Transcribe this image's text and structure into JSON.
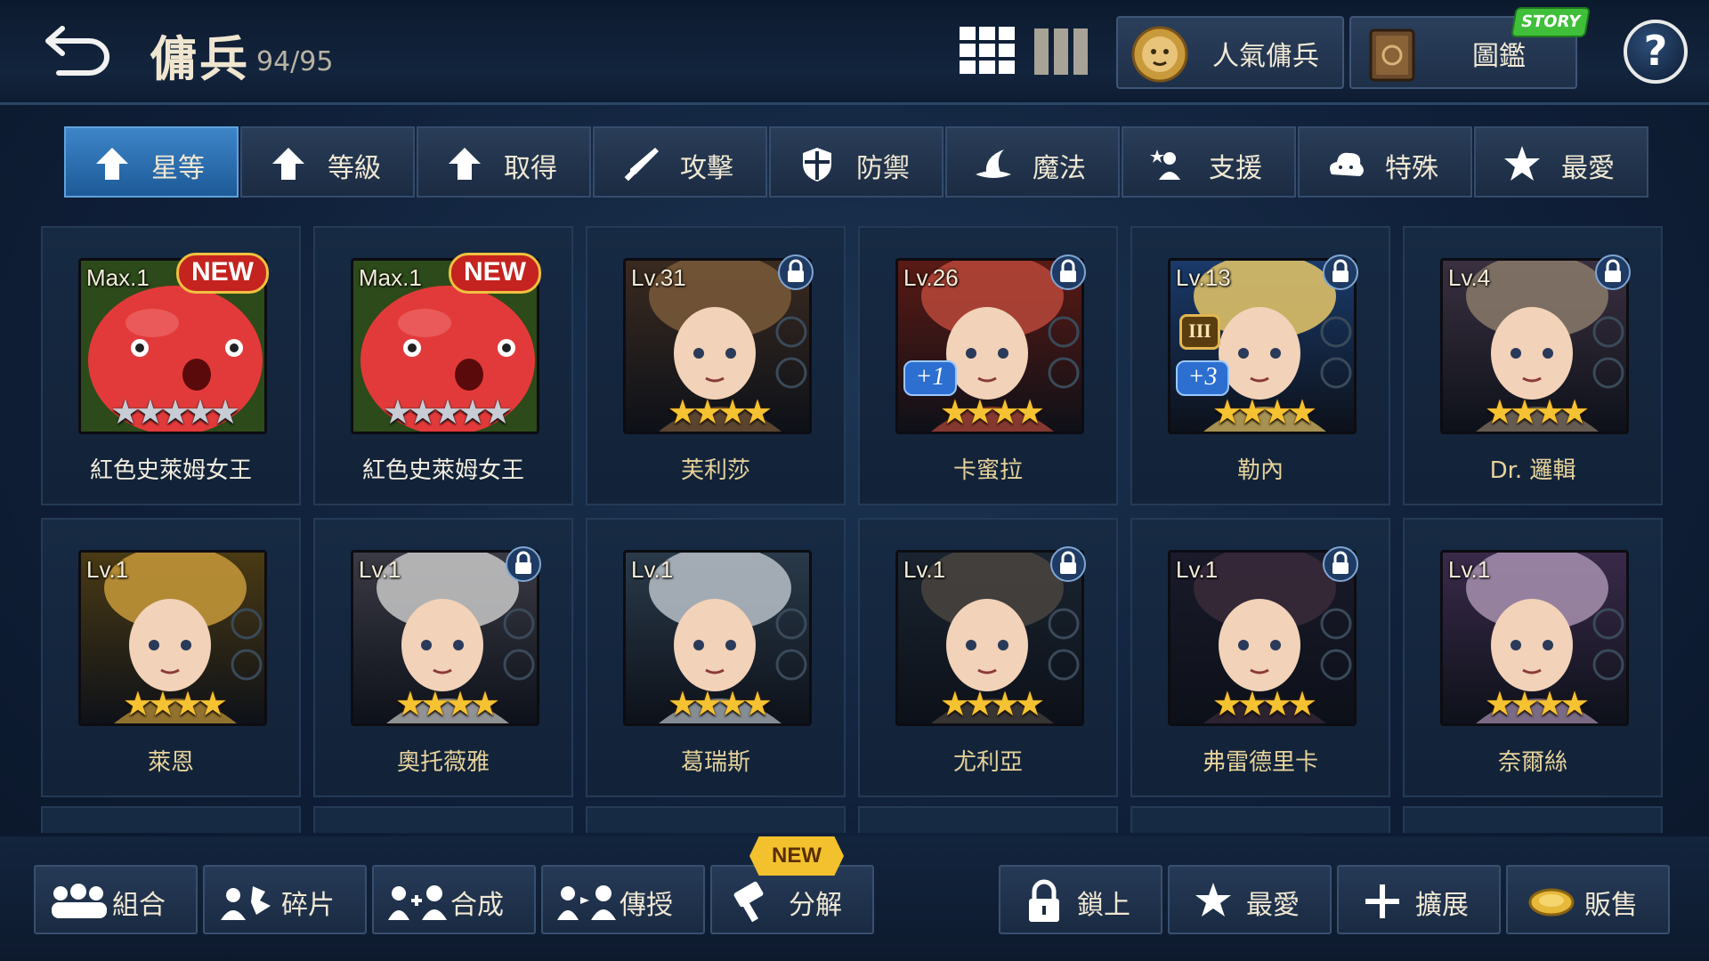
{
  "header": {
    "back_icon": "back-arrow-icon",
    "title": "傭兵",
    "count": "94/95",
    "popular_label": "人氣傭兵",
    "codex_label": "圖鑑",
    "story_badge": "STORY",
    "help_label": "?"
  },
  "tabs": [
    {
      "label": "星等",
      "icon": "arrow-up-icon",
      "active": true
    },
    {
      "label": "等級",
      "icon": "arrow-up-icon",
      "active": false
    },
    {
      "label": "取得",
      "icon": "arrow-up-icon",
      "active": false
    },
    {
      "label": "攻擊",
      "icon": "sword-icon",
      "active": false
    },
    {
      "label": "防禦",
      "icon": "shield-icon",
      "active": false
    },
    {
      "label": "魔法",
      "icon": "witch-hat-icon",
      "active": false
    },
    {
      "label": "支援",
      "icon": "support-icon",
      "active": false
    },
    {
      "label": "特殊",
      "icon": "cloud-icon",
      "active": false
    },
    {
      "label": "最愛",
      "icon": "star-icon",
      "active": false
    }
  ],
  "mercenaries": [
    {
      "level": "Max.1",
      "name": "紅色史萊姆女王",
      "stars": 5,
      "star_color": "silver",
      "new": true,
      "new_label": "NEW",
      "locked": false
    },
    {
      "level": "Max.1",
      "name": "紅色史萊姆女王",
      "stars": 5,
      "star_color": "silver",
      "new": true,
      "new_label": "NEW",
      "locked": false
    },
    {
      "level": "Lv.31",
      "name": "芙利莎",
      "stars": 4,
      "star_color": "gold",
      "new": false,
      "locked": true
    },
    {
      "level": "Lv.26",
      "name": "卡蜜拉",
      "stars": 4,
      "star_color": "gold",
      "new": false,
      "locked": true,
      "plus": "+1"
    },
    {
      "level": "Lv.13",
      "name": "勒內",
      "stars": 4,
      "star_color": "gold",
      "new": false,
      "locked": true,
      "plus": "+3",
      "rank": "III"
    },
    {
      "level": "Lv.4",
      "name": "Dr. 邏輯",
      "stars": 4,
      "star_color": "gold",
      "new": false,
      "locked": true
    },
    {
      "level": "Lv.1",
      "name": "萊恩",
      "stars": 4,
      "star_color": "gold",
      "new": false,
      "locked": false
    },
    {
      "level": "Lv.1",
      "name": "奧托薇雅",
      "stars": 4,
      "star_color": "gold",
      "new": false,
      "locked": true
    },
    {
      "level": "Lv.1",
      "name": "葛瑞斯",
      "stars": 4,
      "star_color": "gold",
      "new": false,
      "locked": false
    },
    {
      "level": "Lv.1",
      "name": "尤利亞",
      "stars": 4,
      "star_color": "gold",
      "new": false,
      "locked": true
    },
    {
      "level": "Lv.1",
      "name": "弗雷德里卡",
      "stars": 4,
      "star_color": "gold",
      "new": false,
      "locked": true
    },
    {
      "level": "Lv.1",
      "name": "奈爾絲",
      "stars": 4,
      "star_color": "gold",
      "new": false,
      "locked": false
    }
  ],
  "bottom": {
    "left": [
      {
        "label": "組合",
        "icon": "team-icon"
      },
      {
        "label": "碎片",
        "icon": "fragment-icon"
      },
      {
        "label": "合成",
        "icon": "fusion-icon"
      },
      {
        "label": "傳授",
        "icon": "transfer-icon"
      },
      {
        "label": "分解",
        "icon": "hammer-icon"
      }
    ],
    "right": [
      {
        "label": "鎖上",
        "icon": "lock-icon"
      },
      {
        "label": "最愛",
        "icon": "star-icon"
      },
      {
        "label": "擴展",
        "icon": "plus-icon"
      },
      {
        "label": "販售",
        "icon": "coin-icon"
      }
    ],
    "new_tag": "NEW"
  }
}
